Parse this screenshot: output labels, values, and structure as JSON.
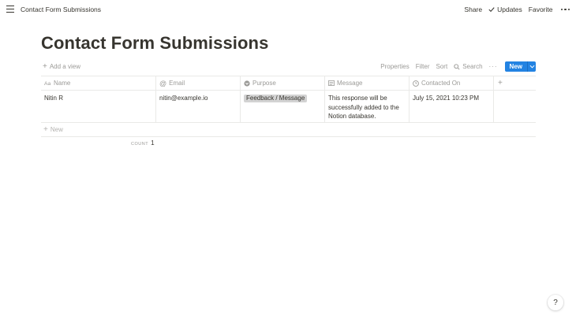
{
  "topbar": {
    "breadcrumb": "Contact Form Submissions",
    "share": "Share",
    "updates": "Updates",
    "favorite": "Favorite"
  },
  "page": {
    "title": "Contact Form Submissions"
  },
  "viewbar": {
    "add_view": "Add a view",
    "properties": "Properties",
    "filter": "Filter",
    "sort": "Sort",
    "search": "Search",
    "more": "···",
    "new": "New"
  },
  "table": {
    "columns": [
      {
        "label": "Name",
        "icon": "text-property-icon"
      },
      {
        "label": "Email",
        "icon": "at-sign-icon"
      },
      {
        "label": "Purpose",
        "icon": "select-property-icon"
      },
      {
        "label": "Message",
        "icon": "lines-property-icon"
      },
      {
        "label": "Contacted On",
        "icon": "clock-icon"
      }
    ],
    "add_column": "+",
    "rows": [
      {
        "name": "Nitin R",
        "email": "nitin@example.io",
        "purpose": "Feedback / Message",
        "message": "This response will be successfully added to the Notion database.",
        "contacted_on": "July 15, 2021 10:23 PM"
      }
    ],
    "new_row": "New",
    "count_label": "COUNT",
    "count_value": "1"
  },
  "help": "?",
  "colors": {
    "accent": "#2383e2",
    "text": "#37352f",
    "muted": "#9b9a97",
    "border": "#e9e9e7",
    "tag_bg": "#d3d3d3"
  }
}
